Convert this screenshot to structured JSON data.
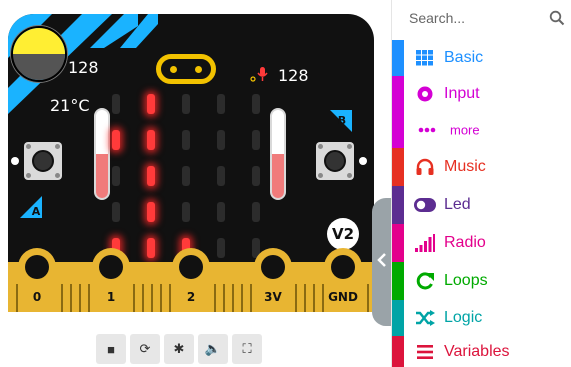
{
  "simulator": {
    "light_level": "128",
    "temperature": "21°C",
    "sound_level": "128",
    "button_a_label": "A",
    "button_b_label": "B",
    "version_badge": "V2",
    "pins": [
      "0",
      "1",
      "2",
      "3V",
      "GND"
    ],
    "led_matrix": [
      [
        0,
        1,
        0,
        0,
        0
      ],
      [
        1,
        1,
        0,
        0,
        0
      ],
      [
        0,
        1,
        0,
        0,
        0
      ],
      [
        0,
        1,
        0,
        0,
        0
      ],
      [
        1,
        1,
        1,
        0,
        0
      ]
    ],
    "temperature_thermometer_fill": 0.5,
    "sound_thermometer_fill": 0.5,
    "light_sensor_fill": 0.5,
    "toolbar": [
      {
        "name": "stop-icon",
        "glyph": "■"
      },
      {
        "name": "restart-icon",
        "glyph": "⟳"
      },
      {
        "name": "debug-icon",
        "glyph": "✱"
      },
      {
        "name": "mute-icon",
        "glyph": "🔈"
      },
      {
        "name": "fullscreen-icon",
        "glyph": "⛶"
      }
    ]
  },
  "toolbox": {
    "search_placeholder": "Search...",
    "categories": [
      {
        "label": "Basic",
        "color": "#1e90ff",
        "icon": "grid-icon"
      },
      {
        "label": "Input",
        "color": "#d400d4",
        "icon": "input-icon"
      },
      {
        "label": "more",
        "color": "#d400d4",
        "icon": "more-icon",
        "sub": true
      },
      {
        "label": "Music",
        "color": "#e63022",
        "icon": "headphones-icon"
      },
      {
        "label": "Led",
        "color": "#5c2d91",
        "icon": "toggle-icon"
      },
      {
        "label": "Radio",
        "color": "#e3008c",
        "icon": "signal-icon"
      },
      {
        "label": "Loops",
        "color": "#00aa00",
        "icon": "loop-icon"
      },
      {
        "label": "Logic",
        "color": "#00a4a6",
        "icon": "shuffle-icon"
      },
      {
        "label": "Variables",
        "color": "#dc143c",
        "icon": "list-icon"
      }
    ]
  }
}
